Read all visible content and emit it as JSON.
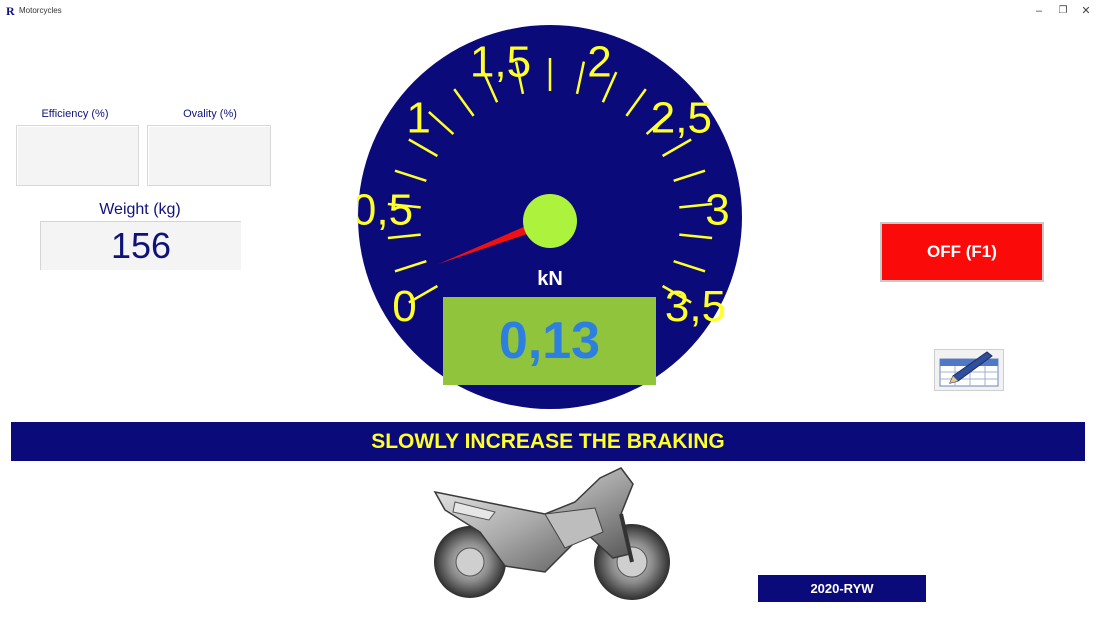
{
  "window": {
    "title": "Motorcycles",
    "icon_letter": "R",
    "minimize_glyph": "–",
    "restore_glyph": "❐",
    "close_glyph": "✕"
  },
  "metrics": {
    "efficiency_label": "Efficiency (%)",
    "efficiency_value": "",
    "ovality_label": "Ovality (%)",
    "ovality_value": "",
    "weight_label": "Weight (kg)",
    "weight_value": "156"
  },
  "gauge": {
    "unit": "kN",
    "value": 0.13,
    "display_value": "0,13",
    "min": 0,
    "max": 3.5,
    "scale_labels": [
      "0",
      "0,5",
      "1",
      "1,5",
      "2",
      "2,5",
      "3",
      "3,5"
    ],
    "colors": {
      "dial": "#0a0a7a",
      "ticks": "#ffff2a",
      "needle": "#ee1111",
      "hub": "#adf23c",
      "display_bg": "#8fc43c",
      "display_text": "#2d7fe0"
    }
  },
  "controls": {
    "off_button_label": "OFF (F1)",
    "edit_icon": "table-pencil-icon"
  },
  "status": {
    "message": "SLOWLY INCREASE THE BRAKING",
    "version": "2020-RYW"
  }
}
